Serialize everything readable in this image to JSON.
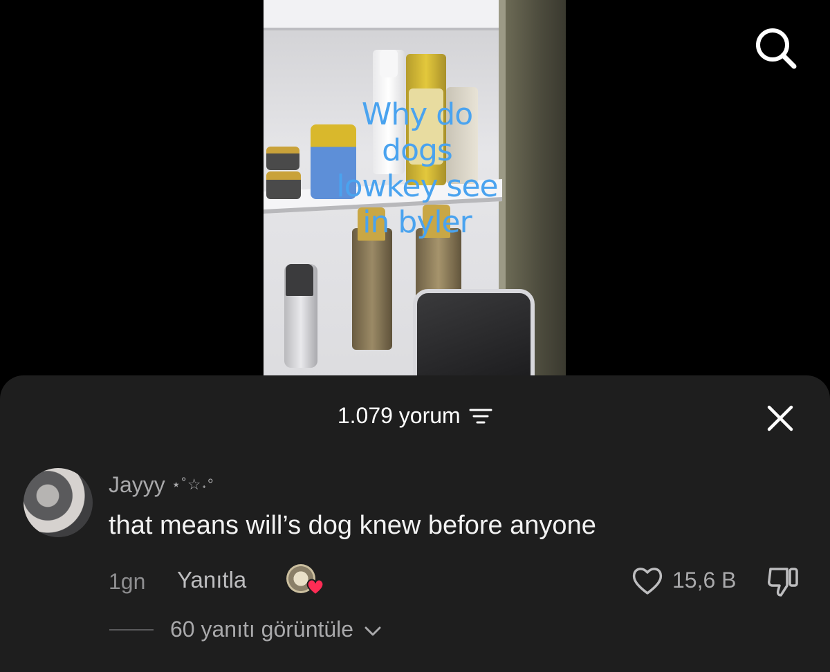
{
  "video": {
    "overlay_text": "Why do\ndogs\nlowkey see\nin byler"
  },
  "top_bar": {
    "search_icon": "search-icon"
  },
  "comments_sheet": {
    "count_label": "1.079 yorum",
    "filter_icon": "filter-icon",
    "close_icon": "close-icon",
    "comment": {
      "username": "Jayyy",
      "username_decoration": "⋆˚☆˖°",
      "text": "that means will’s dog knew before anyone",
      "time": "1gn",
      "reply_label": "Yanıtla",
      "like_count": "15,6 B",
      "view_replies_label": "60 yanıtı görüntüle"
    }
  },
  "colors": {
    "sheet_bg": "#1e1e1e",
    "overlay_text": "#4aa3ef",
    "creator_heart": "#fe2c55"
  }
}
